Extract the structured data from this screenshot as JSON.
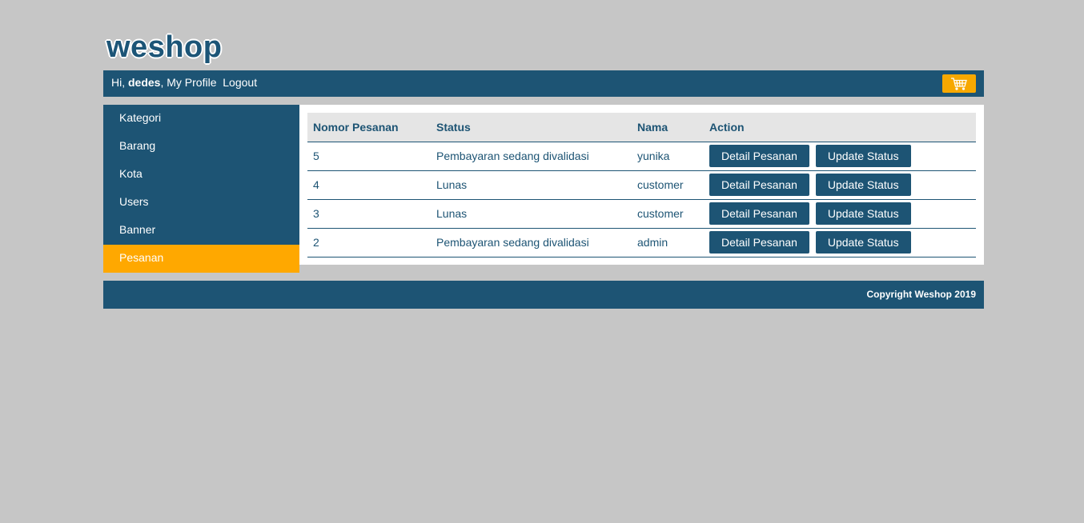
{
  "brand": {
    "logo": "weshop"
  },
  "topbar": {
    "greeting_prefix": "Hi, ",
    "username": "dedes",
    "separator": ",",
    "my_profile": "My Profile",
    "logout": "Logout",
    "cart_icon": "cart-icon"
  },
  "sidebar": {
    "items": [
      {
        "label": "Kategori",
        "active": false
      },
      {
        "label": "Barang",
        "active": false
      },
      {
        "label": "Kota",
        "active": false
      },
      {
        "label": "Users",
        "active": false
      },
      {
        "label": "Banner",
        "active": false
      },
      {
        "label": "Pesanan",
        "active": true
      }
    ]
  },
  "table": {
    "headers": [
      "Nomor Pesanan",
      "Status",
      "Nama",
      "Action"
    ],
    "rows": [
      {
        "nomor": "5",
        "status": "Pembayaran sedang divalidasi",
        "nama": "yunika"
      },
      {
        "nomor": "4",
        "status": "Lunas",
        "nama": "customer"
      },
      {
        "nomor": "3",
        "status": "Lunas",
        "nama": "customer"
      },
      {
        "nomor": "2",
        "status": "Pembayaran sedang divalidasi",
        "nama": "admin"
      }
    ],
    "detail_label": "Detail Pesanan",
    "update_label": "Update Status"
  },
  "footer": {
    "copyright": "Copyright Weshop 2019"
  },
  "colors": {
    "primary": "#1d5474",
    "accent": "#ffa800",
    "background": "#c6c6c6"
  }
}
